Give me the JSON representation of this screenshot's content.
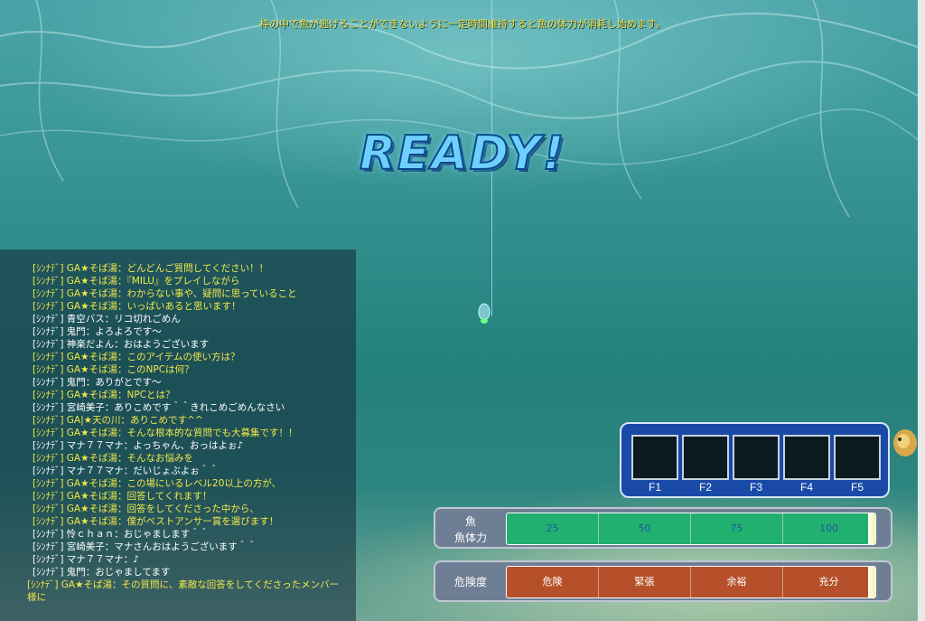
{
  "hint": {
    "text": "枠の中で魚が逃げることができないように一定時間維持すると魚の体力が消耗し始めます。"
  },
  "ready": {
    "text": "READY!"
  },
  "chat": {
    "lines": [
      {
        "text": "[ｼﾝﾅﾃﾞ] GA★そば湯：どんどんご質問してください！！",
        "color": "yellow"
      },
      {
        "text": "[ｼﾝﾅﾃﾞ] GA★そば湯：『MILU』をプレイしながら",
        "color": "yellow"
      },
      {
        "text": "[ｼﾝﾅﾃﾞ] GA★そば湯：わからない事や、疑問に思っていること",
        "color": "yellow"
      },
      {
        "text": "[ｼﾝﾅﾃﾞ] GA★そば湯：いっぱいあると思います！",
        "color": "yellow"
      },
      {
        "text": "[ｼﾝﾅﾃﾞ] 青空バス：リコ切れごめん",
        "color": "white"
      },
      {
        "text": "[ｼﾝﾅﾃﾞ] 鬼門：よろよろです～",
        "color": "white"
      },
      {
        "text": "[ｼﾝﾅﾃﾞ] 神楽だよん：おはようございます",
        "color": "white"
      },
      {
        "text": "[ｼﾝﾅﾃﾞ] GA★そば湯：このアイテムの使い方は？",
        "color": "yellow"
      },
      {
        "text": "[ｼﾝﾅﾃﾞ] GA★そば湯：このNPCは何？",
        "color": "yellow"
      },
      {
        "text": "[ｼﾝﾅﾃﾞ] 鬼門：ありがとです～",
        "color": "white"
      },
      {
        "text": "[ｼﾝﾅﾃﾞ] GA★そば湯：NPCとは？",
        "color": "yellow"
      },
      {
        "text": "[ｼﾝﾅﾃﾞ] 宮崎美子：ありこめです＾＾きれこめごめんなさい",
        "color": "white"
      },
      {
        "text": "[ｼﾝﾅﾃﾞ] GA|★天の川：ありこめです^^",
        "color": "yellow"
      },
      {
        "text": "[ｼﾝﾅﾃﾞ] GA★そば湯：そんな根本的な質問でも大募集です！！",
        "color": "yellow"
      },
      {
        "text": "[ｼﾝﾅﾃﾞ] マナ７７マナ：よっちゃん、おっはよぉ♪",
        "color": "white"
      },
      {
        "text": "[ｼﾝﾅﾃﾞ] GA★そば湯：そんなお悩みを",
        "color": "yellow"
      },
      {
        "text": "[ｼﾝﾅﾃﾞ] マナ７７マナ：だいじょぶよぉ＾＾",
        "color": "white"
      },
      {
        "text": "[ｼﾝﾅﾃﾞ] GA★そば湯：この場にいるレベル20以上の方が、",
        "color": "yellow"
      },
      {
        "text": "[ｼﾝﾅﾃﾞ] GA★そば湯：回答してくれます！",
        "color": "yellow"
      },
      {
        "text": "[ｼﾝﾅﾃﾞ] GA★そば湯：回答をしてくださった中から、",
        "color": "yellow"
      },
      {
        "text": "[ｼﾝﾅﾃﾞ] GA★そば湯：僕がベストアンサー賞を選びます！",
        "color": "yellow"
      },
      {
        "text": "[ｼﾝﾅﾃﾞ] 怜ｃｈａｎ：おじゃまします＾＾",
        "color": "white"
      },
      {
        "text": "[ｼﾝﾅﾃﾞ] 宮崎美子：マナさんおはようございます＾＾",
        "color": "white"
      },
      {
        "text": "[ｼﾝﾅﾃﾞ] マナ７７マナ：♪",
        "color": "white"
      },
      {
        "text": "[ｼﾝﾅﾃﾞ] 鬼門：おじゃましてます",
        "color": "white"
      },
      {
        "text": "[ｼﾝﾅﾃﾞ] GA★そば湯：その質問に、素敵な回答をしてくださったメンバー様に",
        "color": "yellow",
        "wrap": true
      }
    ]
  },
  "hotkeys": {
    "slots": [
      {
        "label": "F1"
      },
      {
        "label": "F2"
      },
      {
        "label": "F3"
      },
      {
        "label": "F4"
      },
      {
        "label": "F5"
      }
    ]
  },
  "fish_gauge": {
    "label_top": "魚",
    "label_bottom": "魚体力",
    "segments": [
      "25",
      "50",
      "75",
      "100"
    ],
    "fill_color": "#22b06e",
    "text_color": "#1a5aa0",
    "level_percent": 100
  },
  "danger_gauge": {
    "label": "危険度",
    "segments": [
      "危険",
      "緊張",
      "余裕",
      "充分"
    ],
    "fill_color": "#b5502a",
    "text_color": "#ffffff",
    "level_percent": 100
  }
}
